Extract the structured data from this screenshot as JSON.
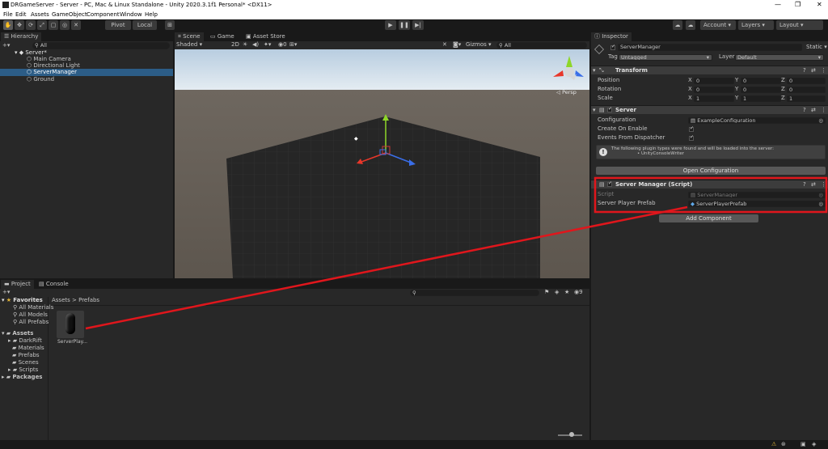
{
  "window": {
    "title": "DRGameServer - Server - PC, Mac & Linux Standalone - Unity 2020.3.1f1 Personal* <DX11>"
  },
  "menu": [
    "File",
    "Edit",
    "Assets",
    "GameObject",
    "Component",
    "Window",
    "Help"
  ],
  "toolbar": {
    "pivot": "Pivot",
    "local": "Local",
    "account": "Account",
    "layers": "Layers",
    "layout": "Layout"
  },
  "hierarchy": {
    "tab": "Hierarchy",
    "search_placeholder": "All",
    "scene": "Server*",
    "items": [
      "Main Camera",
      "Directional Light",
      "ServerManager",
      "Ground"
    ]
  },
  "scene_view": {
    "tabs": [
      "Scene",
      "Game",
      "Asset Store"
    ],
    "shading": "Shaded",
    "mode_2d": "2D",
    "gizmos": "Gizmos",
    "search_placeholder": "All",
    "persp": "◁ Persp",
    "fx_count": "0"
  },
  "project": {
    "tabs": [
      "Project",
      "Console"
    ],
    "favorites_label": "Favorites",
    "favorites": [
      "All Materials",
      "All Models",
      "All Prefabs"
    ],
    "assets_label": "Assets",
    "assets": [
      "DarkRift",
      "Materials",
      "Prefabs",
      "Scenes",
      "Scripts"
    ],
    "packages_label": "Packages",
    "breadcrumb": [
      "Assets",
      "Prefabs"
    ],
    "asset_item": "ServerPlay...",
    "hidden_count": "9"
  },
  "inspector": {
    "tab": "Inspector",
    "object_name": "ServerManager",
    "static": "Static",
    "tag_label": "Tag",
    "tag_value": "Untagged",
    "layer_label": "Layer",
    "layer_value": "Default",
    "transform": {
      "title": "Transform",
      "rows": [
        {
          "label": "Position",
          "x": "0",
          "y": "0",
          "z": "0"
        },
        {
          "label": "Rotation",
          "x": "0",
          "y": "0",
          "z": "0"
        },
        {
          "label": "Scale",
          "x": "1",
          "y": "1",
          "z": "1"
        }
      ]
    },
    "server": {
      "title": "Server",
      "configuration_label": "Configuration",
      "configuration_value": "ExampleConfiguration",
      "create_on_enable": "Create On Enable",
      "events_from_dispatcher": "Events From Dispatcher",
      "info_line1": "The following plugin types were found and will be loaded into the server:",
      "info_line2": "• UnityConsoleWriter",
      "open_config": "Open Configuration"
    },
    "server_manager": {
      "title": "Server Manager (Script)",
      "script_label": "Script",
      "script_value": "ServerManager",
      "prefab_label": "Server Player Prefab",
      "prefab_value": "ServerPlayerPrefab"
    },
    "add_component": "Add Component"
  },
  "colors": {
    "highlight": "#2c5d87",
    "annotation": "#e0161c",
    "bg": "#282828"
  }
}
